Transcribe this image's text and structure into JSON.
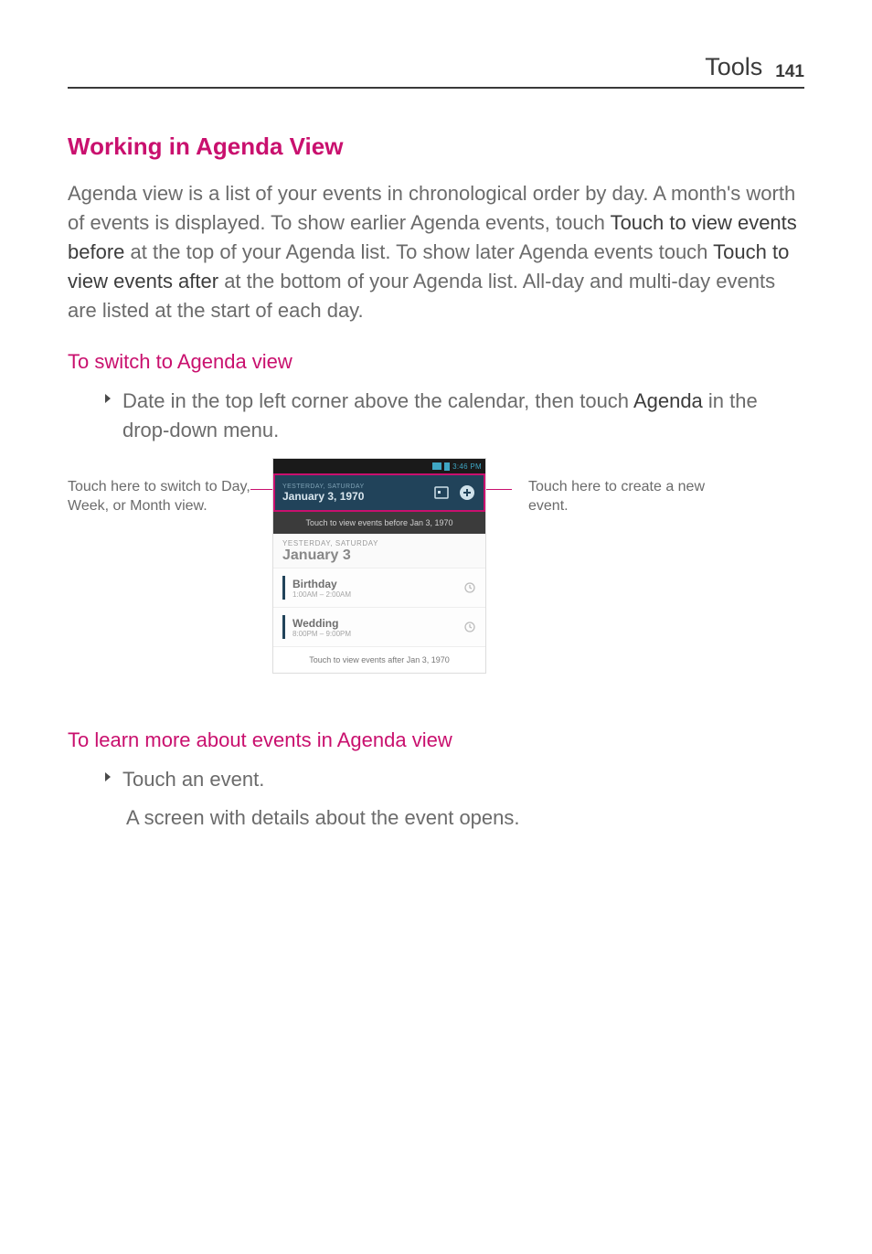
{
  "header": {
    "section": "Tools",
    "page": "141"
  },
  "h2": "Working in Agenda View",
  "intro": {
    "p1": "Agenda view is a list of your events in chronological order by day. A month's worth of events is displayed. To show earlier Agenda events, touch ",
    "b1": "Touch to view events before",
    "p2": " at the top of your Agenda list. To show later Agenda events touch ",
    "b2": "Touch to view events after",
    "p3": " at the bottom of your Agenda list. All-day and multi-day events are listed at the start of each day."
  },
  "sub1": "To switch to Agenda view",
  "bullet1": {
    "pre": "Date in the top left corner above the calendar, then touch ",
    "bold": "Agenda",
    "post": " in the drop-down menu."
  },
  "callouts": {
    "left": "Touch here to switch to Day, Week, or Month view.",
    "right": "Touch here to create a new event."
  },
  "phone": {
    "status_time": "3:46 PM",
    "titlebar_sub": "YESTERDAY, SATURDAY",
    "titlebar_main": "January 3, 1970",
    "before": "Touch to view events before Jan 3, 1970",
    "dow": "YESTERDAY, SATURDAY",
    "dom": "January 3",
    "events": [
      {
        "title": "Birthday",
        "time": "1:00AM – 2:00AM"
      },
      {
        "title": "Wedding",
        "time": "8:00PM – 9:00PM"
      }
    ],
    "after": "Touch to view events after Jan 3, 1970"
  },
  "sub2": "To learn more about events in Agenda view",
  "bullet2": "Touch an event.",
  "after2": "A screen with details about the event opens."
}
